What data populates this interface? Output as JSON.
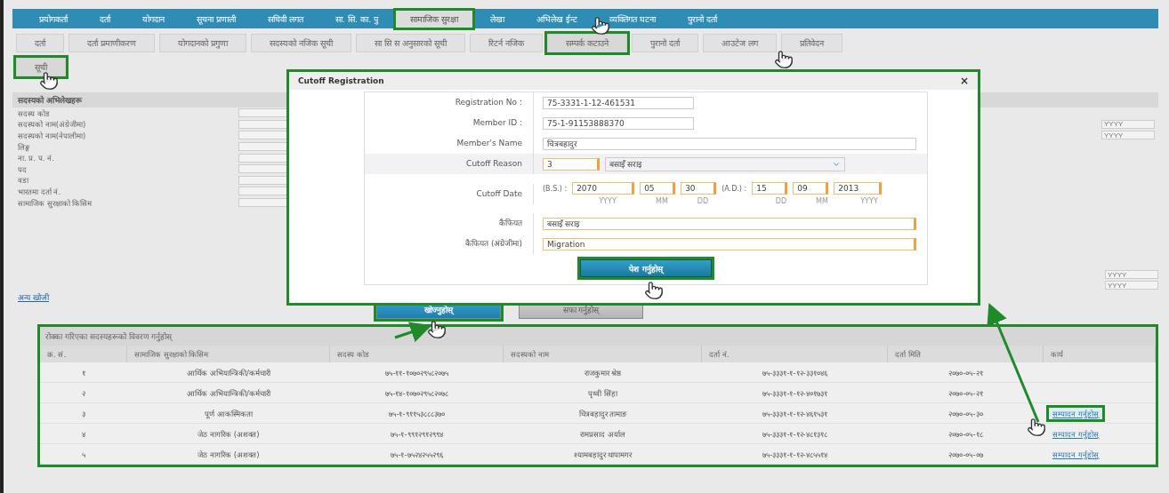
{
  "top_menu": [
    {
      "label": "प्रयोगकर्ता",
      "selected": false
    },
    {
      "label": "दर्ता",
      "selected": false
    },
    {
      "label": "योगदान",
      "selected": false
    },
    {
      "label": "सूचना प्रणाली",
      "selected": false
    },
    {
      "label": "सचिवी लगत",
      "selected": false
    },
    {
      "label": "सा. सि. का. पु",
      "selected": false
    },
    {
      "label": "सामाजिक सुरक्षा",
      "selected": true
    },
    {
      "label": "लेखा",
      "selected": false
    },
    {
      "label": "अभिलेख ईन्ट",
      "selected": false
    },
    {
      "label": "व्यक्तिगत घटना",
      "selected": false
    },
    {
      "label": "पुरानो दर्ता",
      "selected": false
    }
  ],
  "sub_tabs": [
    {
      "label": "दर्ता",
      "selected": false
    },
    {
      "label": "दर्ता प्रमाणीकरण",
      "selected": false
    },
    {
      "label": "योगदानको प्रगुणा",
      "selected": false
    },
    {
      "label": "सदस्यको नजिक सूची",
      "selected": false
    },
    {
      "label": "सा सि स अनुसारको सूची",
      "selected": false
    },
    {
      "label": "रिटर्न नजिक",
      "selected": false
    },
    {
      "label": "सम्पर्क कटाउने",
      "selected": true
    },
    {
      "label": "पुरानो दर्ता",
      "selected": false
    },
    {
      "label": "आउटेज लग",
      "selected": false
    },
    {
      "label": "प्रतिवेदन",
      "selected": false
    }
  ],
  "list_tab": {
    "label": "सूची",
    "selected": true
  },
  "search_form": {
    "title": "सदस्यको अभिलेखहरू",
    "fields": [
      {
        "label": "सदस्य कोड"
      },
      {
        "label": "सदस्यको नाम(अंग्रेजीमा)",
        "side_placeholder": "YYYY"
      },
      {
        "label": "सदस्यको नाम(नेपालीमा)",
        "side_placeholder": "YYYY"
      },
      {
        "label": "लिङ्ग"
      },
      {
        "label": "ना. प्र. प. नं."
      },
      {
        "label": "पद"
      },
      {
        "label": "वडा"
      },
      {
        "label": "भारतमा दर्ता नं."
      },
      {
        "label": "सामाजिक सुरक्षाको किसिम"
      }
    ],
    "lower_placeholders": [
      "YYYY",
      "YYYY"
    ]
  },
  "more_link": "अन्य खोजी",
  "buttons": [
    {
      "label": "खोज्नुहोस्",
      "kind": "primary"
    },
    {
      "label": "सफा गर्नुहोस्",
      "kind": "secondary"
    }
  ],
  "table": {
    "title": "रोक्का गरिएका सदस्यहरूको विवरण गर्नुहोस्",
    "columns": [
      "क्र. सं.",
      "सामाजिक सुरक्षाको किसिम",
      "सदस्य कोड",
      "सदस्यको नाम",
      "दर्ता नं.",
      "दर्ता मिति",
      "कार्य"
    ],
    "rows": [
      {
        "cells": [
          "१",
          "आर्थिक अभियान्त्रिकी/कर्मचारी",
          "७५-११-१०७०२९५८२०७५",
          "राजकुमार श्रेष्ठ",
          "७५-३३३१-१-१२-३३१०४६",
          "२०७०-०५-२१"
        ]
      },
      {
        "cells": [
          "२",
          "आर्थिक अभियान्त्रिकी/कर्मचारी",
          "७५-१४-१०७०२९५८२०७८",
          "पृथ्वी सिंहा",
          "७५-३३३१-१-१२-४०१७३१",
          "२०७०-०५-२१"
        ]
      },
      {
        "cells": [
          "३",
          "पूर्ण आकस्मिकता",
          "७५-१-९११५३८८८३७०",
          "चित्रबहादुर तामाङ",
          "७५-३३३१-१-१२-४६१५३१",
          "२०७०-०५-३०"
        ],
        "action": "सम्पादन गर्नुहोस्",
        "selected": true
      },
      {
        "cells": [
          "४",
          "जेठ नागरिक (अशक्त)",
          "७५-१-९९१२९१२९९४",
          "रामप्रसाद अर्याल",
          "७५-३३३१-१-१२-४८१३१८",
          "२०७०-०५-१८"
        ],
        "action": "सम्पादन गर्नुहोस्",
        "selected": false
      },
      {
        "cells": [
          "५",
          "जेठ नागरिक (अशक्त)",
          "७५-१-७५२४२५५२९६",
          "श्यामबहादुर थापामगर",
          "७५-३३३१-१-१२-४८५५१४",
          "२०७०-०५-०७"
        ],
        "action": "सम्पादन गर्नुहोस्",
        "selected": false
      }
    ]
  },
  "modal": {
    "title": "Cutoff Registration",
    "close": "×",
    "registration_no": {
      "label": "Registration No :",
      "value": "75-3331-1-12-461531"
    },
    "member_id": {
      "label": "Member ID :",
      "value": "75-1-91153888370"
    },
    "member_name": {
      "label": "Member's Name",
      "value": "चित्रबहादुर"
    },
    "cutoff_reason": {
      "label": "Cutoff Reason",
      "code": "3",
      "value": "बसाइँ सराइ"
    },
    "cutoff_date": {
      "label": "Cutoff Date",
      "bs_label": "(B.S.) :",
      "bs": [
        "2070",
        "05",
        "30"
      ],
      "bs_hints": [
        "YYYY",
        "MM",
        "DD"
      ],
      "ad_label": "(A.D.) :",
      "ad": [
        "15",
        "09",
        "2013"
      ],
      "ad_hints": [
        "DD",
        "MM",
        "YYYY"
      ]
    },
    "remarks": {
      "label": "कैफियत",
      "value": "बसाइँ सराइ"
    },
    "remarks_en": {
      "label": "कैफियत (अंग्रेजीमा)",
      "value": "Migration"
    },
    "submit": "पेश गर्नुहोस्"
  }
}
